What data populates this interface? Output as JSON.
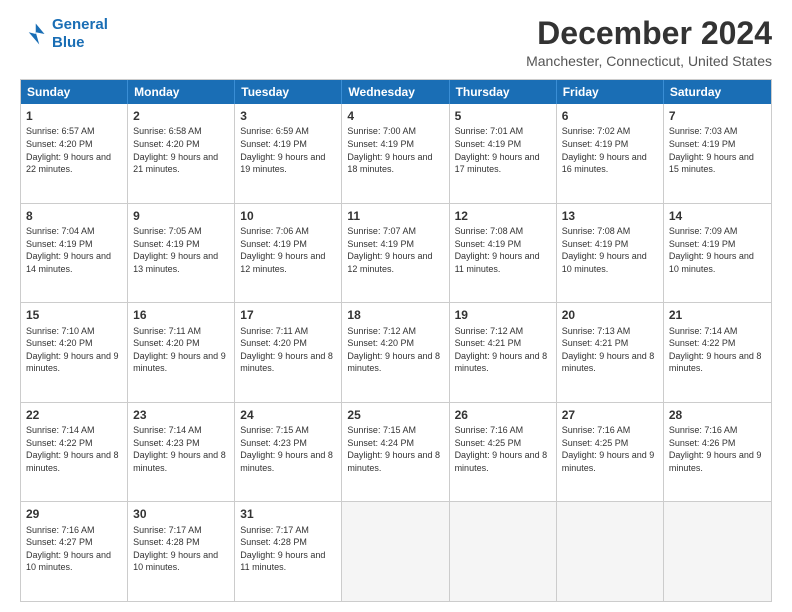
{
  "logo": {
    "line1": "General",
    "line2": "Blue"
  },
  "title": "December 2024",
  "location": "Manchester, Connecticut, United States",
  "header_days": [
    "Sunday",
    "Monday",
    "Tuesday",
    "Wednesday",
    "Thursday",
    "Friday",
    "Saturday"
  ],
  "weeks": [
    [
      {
        "day": "1",
        "sunrise": "Sunrise: 6:57 AM",
        "sunset": "Sunset: 4:20 PM",
        "daylight": "Daylight: 9 hours and 22 minutes."
      },
      {
        "day": "2",
        "sunrise": "Sunrise: 6:58 AM",
        "sunset": "Sunset: 4:20 PM",
        "daylight": "Daylight: 9 hours and 21 minutes."
      },
      {
        "day": "3",
        "sunrise": "Sunrise: 6:59 AM",
        "sunset": "Sunset: 4:19 PM",
        "daylight": "Daylight: 9 hours and 19 minutes."
      },
      {
        "day": "4",
        "sunrise": "Sunrise: 7:00 AM",
        "sunset": "Sunset: 4:19 PM",
        "daylight": "Daylight: 9 hours and 18 minutes."
      },
      {
        "day": "5",
        "sunrise": "Sunrise: 7:01 AM",
        "sunset": "Sunset: 4:19 PM",
        "daylight": "Daylight: 9 hours and 17 minutes."
      },
      {
        "day": "6",
        "sunrise": "Sunrise: 7:02 AM",
        "sunset": "Sunset: 4:19 PM",
        "daylight": "Daylight: 9 hours and 16 minutes."
      },
      {
        "day": "7",
        "sunrise": "Sunrise: 7:03 AM",
        "sunset": "Sunset: 4:19 PM",
        "daylight": "Daylight: 9 hours and 15 minutes."
      }
    ],
    [
      {
        "day": "8",
        "sunrise": "Sunrise: 7:04 AM",
        "sunset": "Sunset: 4:19 PM",
        "daylight": "Daylight: 9 hours and 14 minutes."
      },
      {
        "day": "9",
        "sunrise": "Sunrise: 7:05 AM",
        "sunset": "Sunset: 4:19 PM",
        "daylight": "Daylight: 9 hours and 13 minutes."
      },
      {
        "day": "10",
        "sunrise": "Sunrise: 7:06 AM",
        "sunset": "Sunset: 4:19 PM",
        "daylight": "Daylight: 9 hours and 12 minutes."
      },
      {
        "day": "11",
        "sunrise": "Sunrise: 7:07 AM",
        "sunset": "Sunset: 4:19 PM",
        "daylight": "Daylight: 9 hours and 12 minutes."
      },
      {
        "day": "12",
        "sunrise": "Sunrise: 7:08 AM",
        "sunset": "Sunset: 4:19 PM",
        "daylight": "Daylight: 9 hours and 11 minutes."
      },
      {
        "day": "13",
        "sunrise": "Sunrise: 7:08 AM",
        "sunset": "Sunset: 4:19 PM",
        "daylight": "Daylight: 9 hours and 10 minutes."
      },
      {
        "day": "14",
        "sunrise": "Sunrise: 7:09 AM",
        "sunset": "Sunset: 4:19 PM",
        "daylight": "Daylight: 9 hours and 10 minutes."
      }
    ],
    [
      {
        "day": "15",
        "sunrise": "Sunrise: 7:10 AM",
        "sunset": "Sunset: 4:20 PM",
        "daylight": "Daylight: 9 hours and 9 minutes."
      },
      {
        "day": "16",
        "sunrise": "Sunrise: 7:11 AM",
        "sunset": "Sunset: 4:20 PM",
        "daylight": "Daylight: 9 hours and 9 minutes."
      },
      {
        "day": "17",
        "sunrise": "Sunrise: 7:11 AM",
        "sunset": "Sunset: 4:20 PM",
        "daylight": "Daylight: 9 hours and 8 minutes."
      },
      {
        "day": "18",
        "sunrise": "Sunrise: 7:12 AM",
        "sunset": "Sunset: 4:20 PM",
        "daylight": "Daylight: 9 hours and 8 minutes."
      },
      {
        "day": "19",
        "sunrise": "Sunrise: 7:12 AM",
        "sunset": "Sunset: 4:21 PM",
        "daylight": "Daylight: 9 hours and 8 minutes."
      },
      {
        "day": "20",
        "sunrise": "Sunrise: 7:13 AM",
        "sunset": "Sunset: 4:21 PM",
        "daylight": "Daylight: 9 hours and 8 minutes."
      },
      {
        "day": "21",
        "sunrise": "Sunrise: 7:14 AM",
        "sunset": "Sunset: 4:22 PM",
        "daylight": "Daylight: 9 hours and 8 minutes."
      }
    ],
    [
      {
        "day": "22",
        "sunrise": "Sunrise: 7:14 AM",
        "sunset": "Sunset: 4:22 PM",
        "daylight": "Daylight: 9 hours and 8 minutes."
      },
      {
        "day": "23",
        "sunrise": "Sunrise: 7:14 AM",
        "sunset": "Sunset: 4:23 PM",
        "daylight": "Daylight: 9 hours and 8 minutes."
      },
      {
        "day": "24",
        "sunrise": "Sunrise: 7:15 AM",
        "sunset": "Sunset: 4:23 PM",
        "daylight": "Daylight: 9 hours and 8 minutes."
      },
      {
        "day": "25",
        "sunrise": "Sunrise: 7:15 AM",
        "sunset": "Sunset: 4:24 PM",
        "daylight": "Daylight: 9 hours and 8 minutes."
      },
      {
        "day": "26",
        "sunrise": "Sunrise: 7:16 AM",
        "sunset": "Sunset: 4:25 PM",
        "daylight": "Daylight: 9 hours and 8 minutes."
      },
      {
        "day": "27",
        "sunrise": "Sunrise: 7:16 AM",
        "sunset": "Sunset: 4:25 PM",
        "daylight": "Daylight: 9 hours and 9 minutes."
      },
      {
        "day": "28",
        "sunrise": "Sunrise: 7:16 AM",
        "sunset": "Sunset: 4:26 PM",
        "daylight": "Daylight: 9 hours and 9 minutes."
      }
    ],
    [
      {
        "day": "29",
        "sunrise": "Sunrise: 7:16 AM",
        "sunset": "Sunset: 4:27 PM",
        "daylight": "Daylight: 9 hours and 10 minutes."
      },
      {
        "day": "30",
        "sunrise": "Sunrise: 7:17 AM",
        "sunset": "Sunset: 4:28 PM",
        "daylight": "Daylight: 9 hours and 10 minutes."
      },
      {
        "day": "31",
        "sunrise": "Sunrise: 7:17 AM",
        "sunset": "Sunset: 4:28 PM",
        "daylight": "Daylight: 9 hours and 11 minutes."
      },
      null,
      null,
      null,
      null
    ]
  ]
}
